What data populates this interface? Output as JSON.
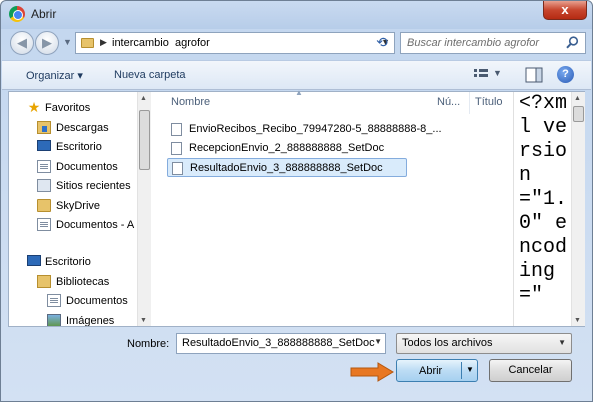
{
  "window": {
    "title": "Abrir",
    "close_glyph": "x"
  },
  "address": {
    "path_segment": "intercambio  agrofor",
    "search_placeholder": "Buscar intercambio  agrofor"
  },
  "toolbar": {
    "organize_label": "Organizar ▾",
    "new_folder_label": "Nueva carpeta",
    "help_glyph": "?"
  },
  "nav": {
    "items": [
      {
        "label": "Favoritos",
        "icon": "star-icon"
      },
      {
        "label": "Descargas",
        "icon": "downloads-folder-icon"
      },
      {
        "label": "Escritorio",
        "icon": "desktop-icon"
      },
      {
        "label": "Documentos",
        "icon": "document-icon"
      },
      {
        "label": "Sitios recientes",
        "icon": "recent-places-icon"
      },
      {
        "label": "SkyDrive",
        "icon": "folder-icon"
      },
      {
        "label": "Documentos - A",
        "icon": "document-icon"
      },
      {
        "label": "Escritorio",
        "icon": "desktop-icon"
      },
      {
        "label": "Bibliotecas",
        "icon": "library-icon"
      },
      {
        "label": "Documentos",
        "icon": "document-icon"
      },
      {
        "label": "Imágenes",
        "icon": "pictures-icon"
      }
    ]
  },
  "columns": {
    "name": "Nombre",
    "number": "Nú...",
    "title": "Título"
  },
  "files": [
    {
      "name": "EnvioRecibos_Recibo_79947280-5_88888888-8_...",
      "selected": false
    },
    {
      "name": "RecepcionEnvio_2_888888888_SetDoc",
      "selected": false
    },
    {
      "name": "ResultadoEnvio_3_888888888_SetDoc",
      "selected": true
    }
  ],
  "preview": {
    "text": "<?xml version=\"1.0\" encoding=\""
  },
  "bottom": {
    "filename_label": "Nombre:",
    "filename_value": "ResultadoEnvio_3_888888888_SetDoc",
    "filter_value": "Todos los archivos",
    "open_label": "Abrir",
    "cancel_label": "Cancelar"
  },
  "colors": {
    "accent": "#e87722",
    "selection": "#d9ebfb"
  }
}
